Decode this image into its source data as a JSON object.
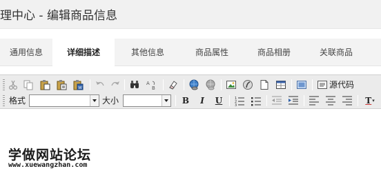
{
  "page": {
    "title": "理中心 - 编辑商品信息"
  },
  "tabs": [
    {
      "label": "通用信息",
      "active": false
    },
    {
      "label": "详细描述",
      "active": true
    },
    {
      "label": "其他信息",
      "active": false
    },
    {
      "label": "商品属性",
      "active": false
    },
    {
      "label": "商品相册",
      "active": false
    },
    {
      "label": "关联商品",
      "active": false
    }
  ],
  "editor": {
    "toolbar": {
      "row1": {
        "icons": [
          "cut-icon",
          "copy-icon",
          "paste-icon",
          "paste-text-icon",
          "paste-word-icon",
          "undo-icon",
          "redo-icon",
          "find-icon",
          "replace-icon",
          "remove-format-icon",
          "link-icon",
          "unlink-icon",
          "image-icon",
          "flash-icon",
          "blank-page-icon",
          "table-icon",
          "select-all-icon",
          "source-icon"
        ],
        "source_label": "源代码"
      },
      "row2": {
        "format_label": "格式",
        "format_value": "",
        "size_label": "大小",
        "size_value": "",
        "bold": "B",
        "italic": "I",
        "underline": "U",
        "text_color_letter": "T"
      }
    }
  },
  "watermark": {
    "text": "学做网站论坛",
    "url": "www.xuewangzhan.com"
  },
  "colors": {
    "title_bar": "#f1f1f1",
    "tabs_bg": "#f3f3f3",
    "toolbar_bg": "#ebebeb"
  }
}
